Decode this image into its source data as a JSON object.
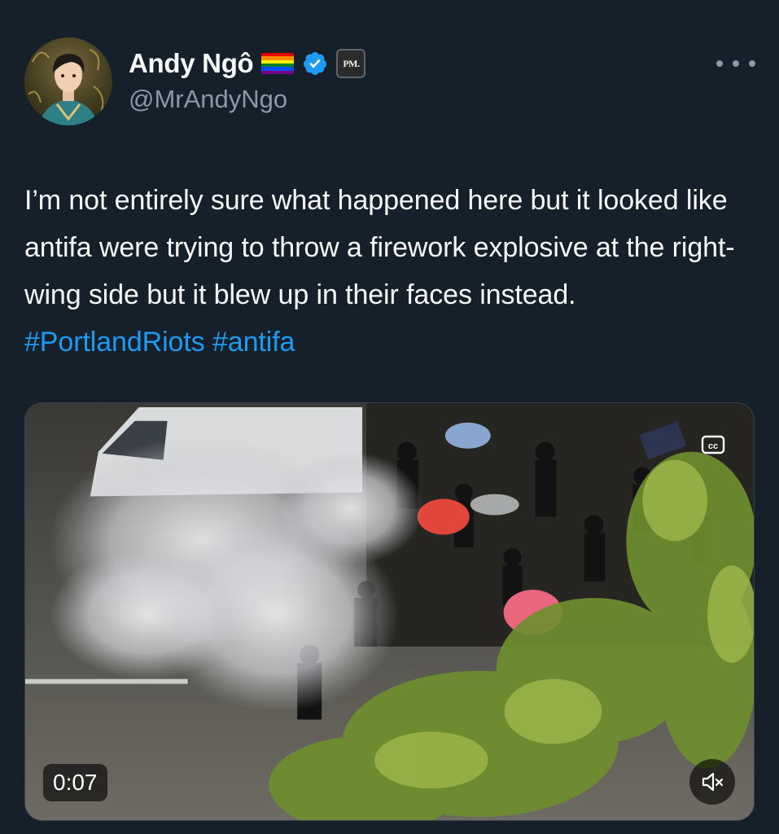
{
  "author": {
    "display_name": "Andy Ngô",
    "handle": "@MrAndyNgo",
    "badges": [
      "rainbow-flag-icon",
      "verified-icon"
    ],
    "affiliate_label": "PM."
  },
  "tweet": {
    "text_plain": "I’m not entirely sure what happened here but it looked like antifa were trying to throw a firework explosive at the right-wing side but it blew up in their faces instead.",
    "hashtags": [
      "#PortlandRiots",
      "#antifa"
    ]
  },
  "media": {
    "type": "video",
    "duration": "0:07",
    "controls": [
      "cc-icon",
      "mute-icon"
    ]
  },
  "colors": {
    "background": "#15202b",
    "text": "#f7f9f9",
    "secondary": "#8b98a5",
    "accent": "#1d9bf0"
  }
}
